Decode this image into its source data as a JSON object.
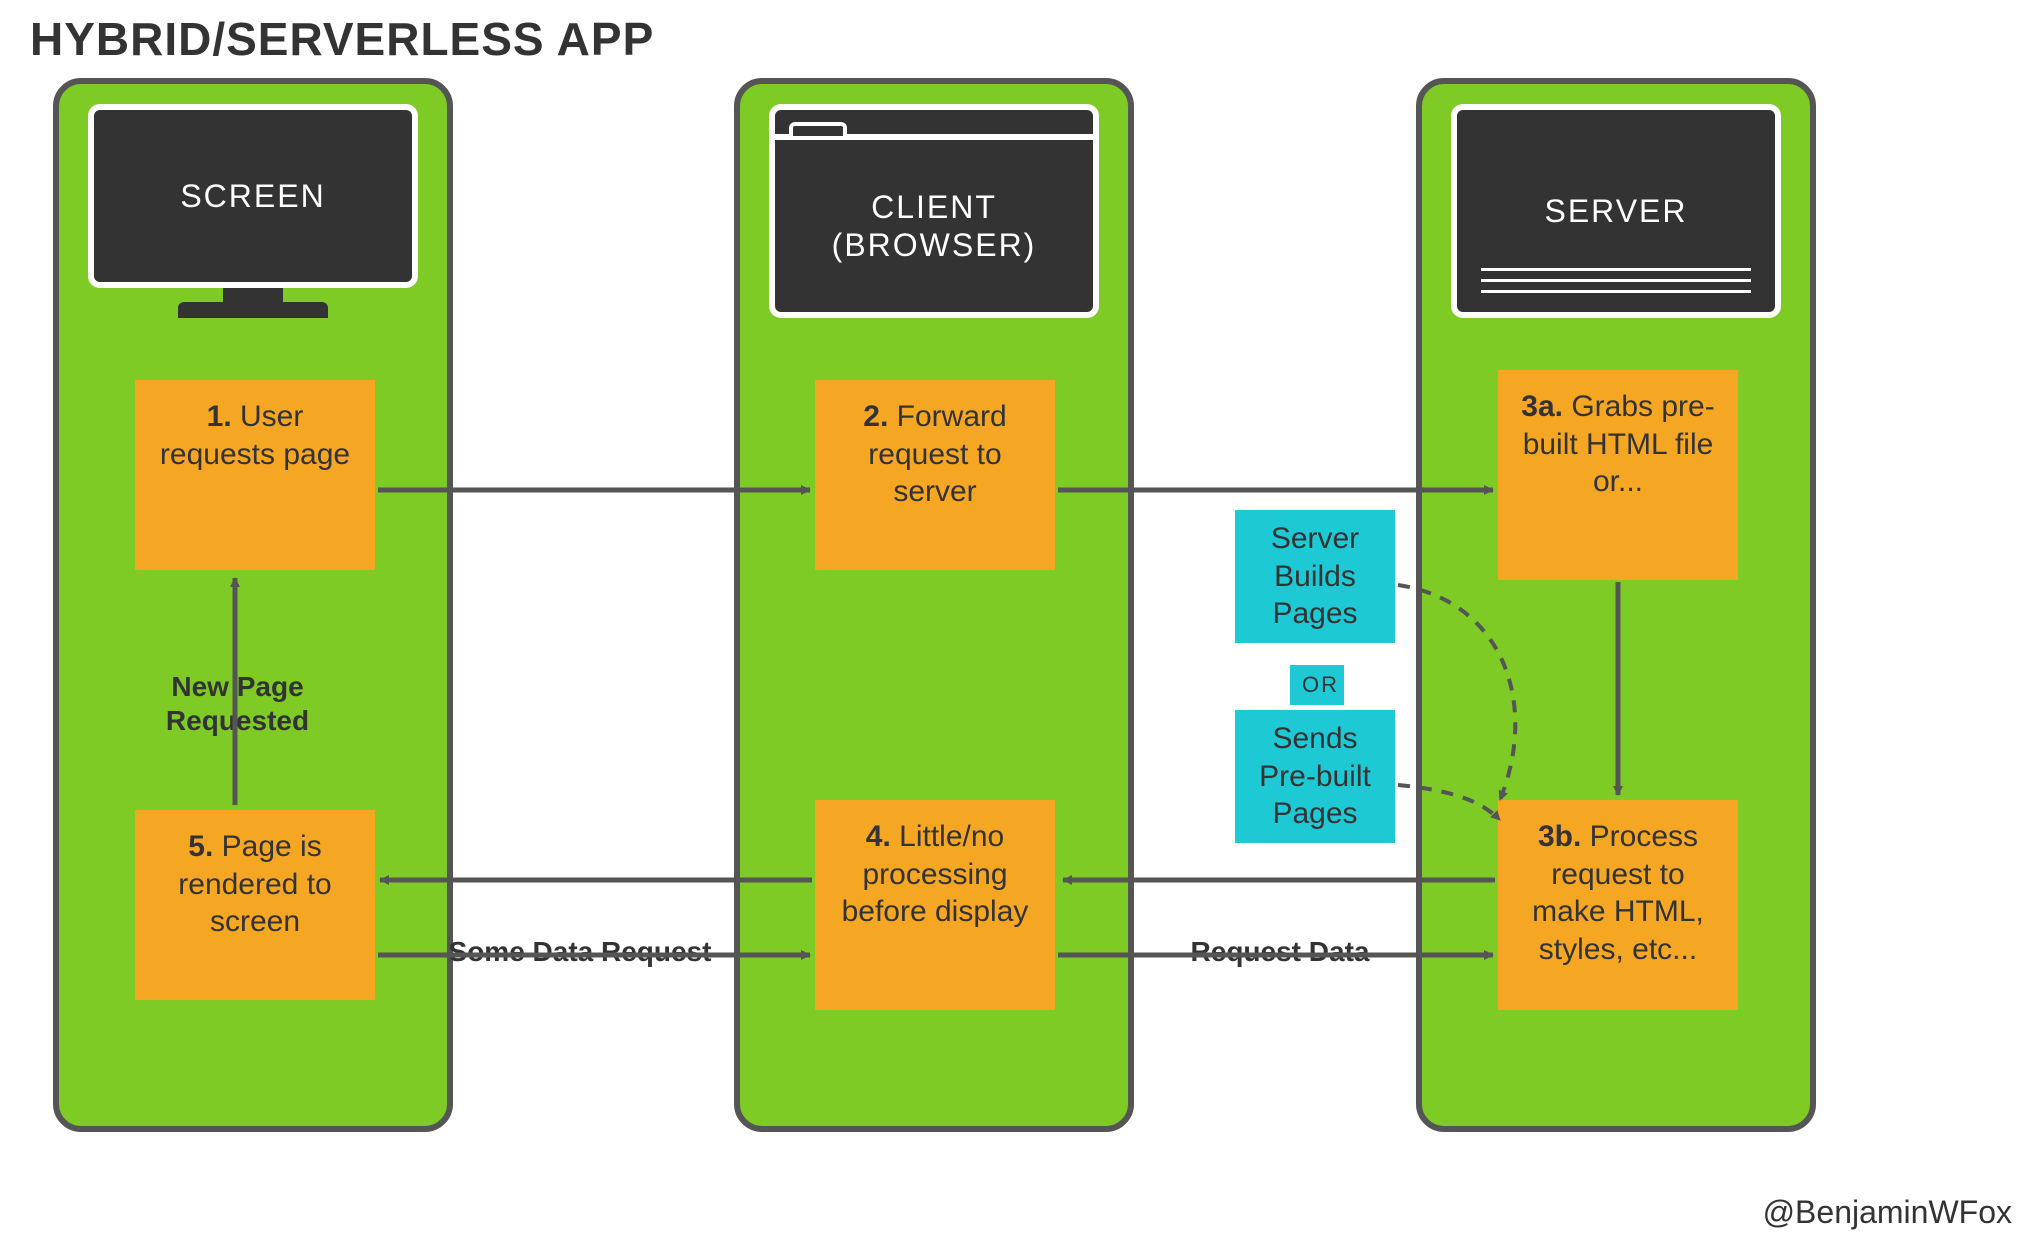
{
  "title": "HYBRID/SERVERLESS APP",
  "attribution": "@BenjaminWFox",
  "columns": {
    "screen": {
      "label": "SCREEN"
    },
    "client": {
      "label": "CLIENT\n(BROWSER)"
    },
    "server": {
      "label": "SERVER"
    }
  },
  "steps": {
    "s1": {
      "num": "1.",
      "text": "User requests page"
    },
    "s2": {
      "num": "2.",
      "text": "Forward request to server"
    },
    "s3a": {
      "num": "3a.",
      "text": "Grabs pre-built HTML file or..."
    },
    "s3b": {
      "num": "3b.",
      "text": "Process request to make HTML, styles, etc..."
    },
    "s4": {
      "num": "4.",
      "text": "Little/no processing before display"
    },
    "s5": {
      "num": "5.",
      "text": "Page is rendered to screen"
    }
  },
  "teal": {
    "top": "Server Builds Pages",
    "or": "OR",
    "bottom": "Sends Pre-built Pages"
  },
  "arrow_labels": {
    "new_page": "New Page Requested",
    "some_data": "Some Data Request",
    "request_data": "Request Data"
  },
  "colors": {
    "column_bg": "#7ecb25",
    "column_border": "#555555",
    "card_bg": "#f5a623",
    "teal_bg": "#1cc9d4",
    "device_bg": "#333333",
    "arrow": "#555555"
  }
}
